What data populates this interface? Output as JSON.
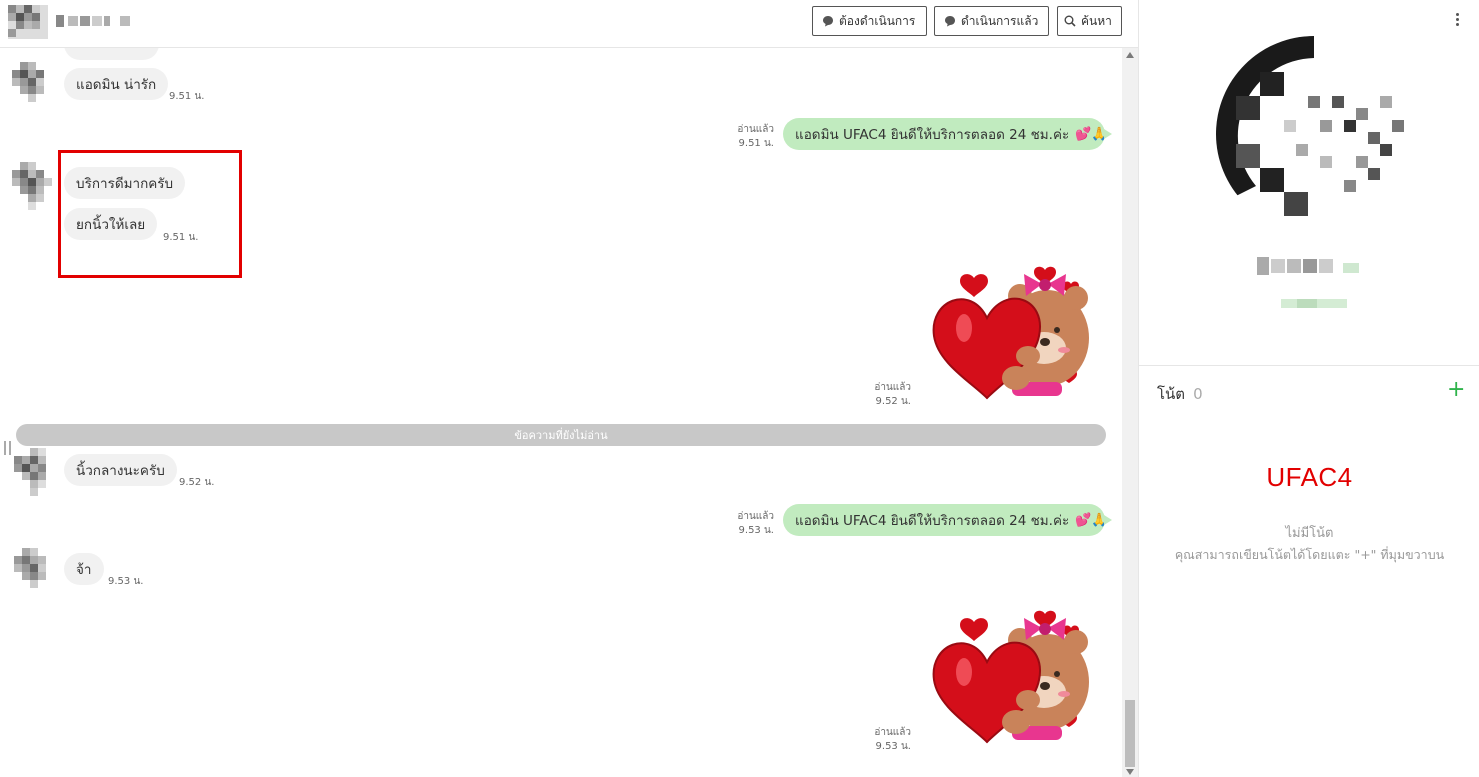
{
  "header": {
    "buttons": {
      "todo": "ต้องดำเนินการ",
      "done": "ดำเนินการแล้ว",
      "search": "ค้นหา"
    }
  },
  "messages": {
    "m1": {
      "text": "แอดมิน น่ารัก",
      "time": "9.51 น."
    },
    "m2": {
      "text": "แอดมิน UFAC4 ยินดีให้บริการตลอด 24 ชม.ค่ะ",
      "emoji": "💕🙏",
      "read": "อ่านแล้ว",
      "time": "9.51 น."
    },
    "m3": {
      "text": "บริการดีมากครับ"
    },
    "m4": {
      "text": "ยกนิ้วให้เลย",
      "time": "9.51 น."
    },
    "sticker1": {
      "read": "อ่านแล้ว",
      "time": "9.52 น."
    },
    "unread_divider": "ข้อความที่ยังไม่อ่าน",
    "m5": {
      "text": "นิ้วกลางนะครับ",
      "time": "9.52 น."
    },
    "m6": {
      "text": "แอดมิน UFAC4 ยินดีให้บริการตลอด 24 ชม.ค่ะ",
      "emoji": "💕🙏",
      "read": "อ่านแล้ว",
      "time": "9.53 น."
    },
    "m7": {
      "text": "จ้า",
      "time": "9.53 น."
    },
    "sticker2": {
      "read": "อ่านแล้ว",
      "time": "9.53 น."
    }
  },
  "sidebar": {
    "note_label": "โน้ต",
    "note_count": "0",
    "add_symbol": "+",
    "brand": "UFAC4",
    "no_note": "ไม่มีโน้ต",
    "no_note_hint": "คุณสามารถเขียนโน้ตได้โดยแตะ \"+\" ที่มุมขวาบน"
  },
  "colors": {
    "accent_green": "#2fb34b",
    "outgoing_bubble": "#c1ebbf",
    "incoming_bubble": "#f1f1f1",
    "highlight_red": "#e20000"
  }
}
